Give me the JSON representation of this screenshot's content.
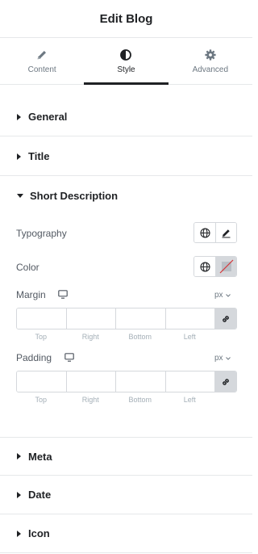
{
  "header": {
    "title": "Edit Blog"
  },
  "tabs": [
    {
      "label": "Content",
      "icon": "pencil-icon",
      "active": false
    },
    {
      "label": "Style",
      "icon": "half-circle-icon",
      "active": true
    },
    {
      "label": "Advanced",
      "icon": "gear-icon",
      "active": false
    }
  ],
  "sections": {
    "general": "General",
    "title": "Title",
    "short_description": "Short Description",
    "meta": "Meta",
    "date": "Date",
    "icon": "Icon"
  },
  "controls": {
    "typography_label": "Typography",
    "color_label": "Color",
    "margin": {
      "label": "Margin",
      "unit": "px",
      "top": "",
      "right": "",
      "bottom": "",
      "left": ""
    },
    "padding": {
      "label": "Padding",
      "unit": "px",
      "top": "",
      "right": "",
      "bottom": "",
      "left": ""
    },
    "dim_labels": {
      "top": "Top",
      "right": "Right",
      "bottom": "Bottom",
      "left": "Left"
    }
  },
  "colors": {
    "text": "#1f2124",
    "muted": "#6d7882",
    "border": "#d5d8dc",
    "accent_active": "#1f2124"
  }
}
